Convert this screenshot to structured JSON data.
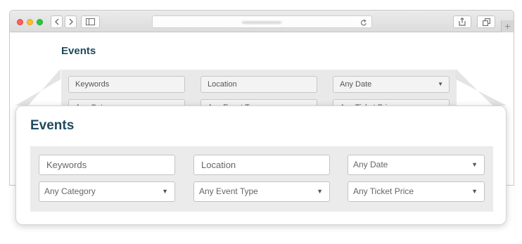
{
  "browser": {
    "buttons": {
      "back": "back-icon",
      "forward": "forward-icon",
      "sidebar": "sidebar-icon",
      "share": "share-icon",
      "tabs": "tabs-icon",
      "reload": "reload-icon",
      "new_tab": "+"
    }
  },
  "page": {
    "title": "Events",
    "search": {
      "keywords_placeholder": "Keywords",
      "location_placeholder": "Location",
      "date": "Any Date",
      "category": "Any Category",
      "event_type": "Any Event Type",
      "ticket_price": "Any Ticket Price"
    }
  },
  "colors": {
    "title": "#1f4a5f",
    "panel": "#ebebeb"
  }
}
